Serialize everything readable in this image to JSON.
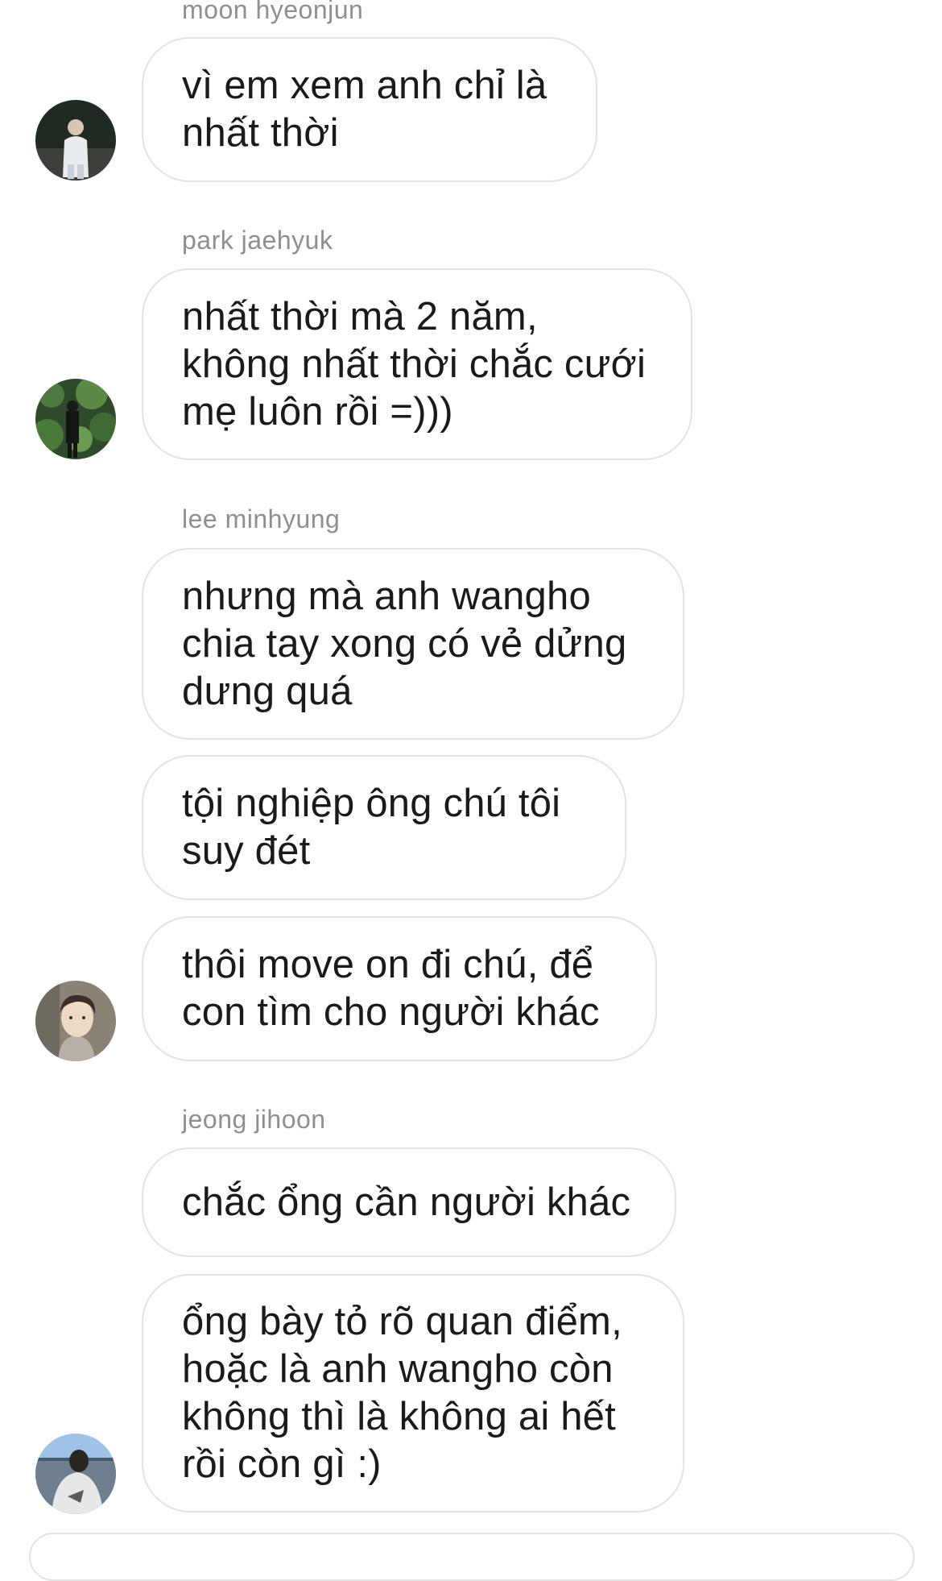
{
  "thread": {
    "groups": [
      {
        "sender": "moon hyeonjun",
        "messages": [
          "vì em xem anh chỉ là\nnhất thời"
        ],
        "avatar_icon": "profile-photo-night-standing"
      },
      {
        "sender": "park jaehyuk",
        "messages": [
          "nhất thời mà 2 năm,\nkhông nhất thời chắc cưới\nmẹ luôn rồi =)))"
        ],
        "avatar_icon": "profile-photo-green-hedge"
      },
      {
        "sender": "lee minhyung",
        "messages": [
          "nhưng mà anh wangho\nchia tay xong có vẻ dửng\ndưng quá",
          "tội nghiệp ông chú tôi\nsuy đét",
          "thôi move on đi chú, để\ncon tìm cho người khác"
        ],
        "avatar_icon": "profile-photo-selfie"
      },
      {
        "sender": "jeong jihoon",
        "messages": [
          "chắc ổng cần người khác",
          "ổng bày tỏ rõ quan điểm,\nhoặc là anh wangho còn\nkhông thì là không ai hết\nrồi còn gì :)"
        ],
        "avatar_icon": "profile-photo-outdoor-shirt"
      }
    ]
  },
  "colors": {
    "bubble_border": "#e3e3e6",
    "sender_name": "#8e8e93",
    "message_text": "#1a1a1a"
  }
}
